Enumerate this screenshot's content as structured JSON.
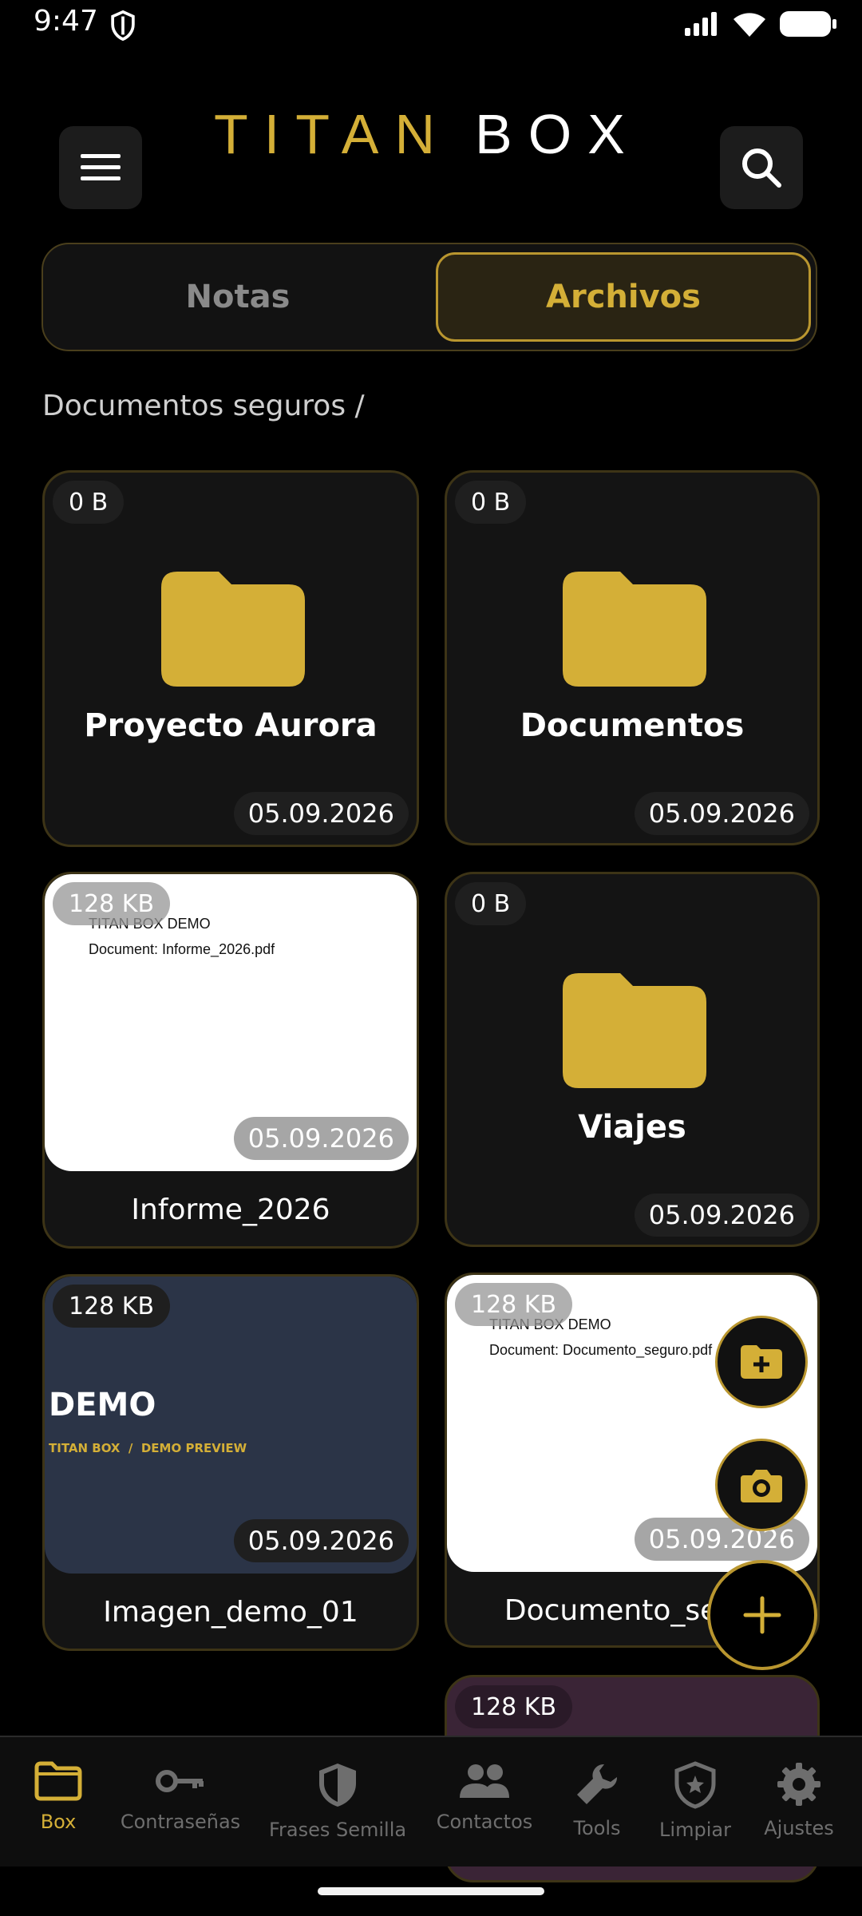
{
  "status_bar": {
    "time": "9:47"
  },
  "header": {
    "logo_part1": "TITAN",
    "logo_part2": "BOX",
    "menu_icon": "hamburger-icon",
    "search_icon": "search-icon"
  },
  "tabs": [
    {
      "label": "Notas",
      "selected": false
    },
    {
      "label": "Archivos",
      "selected": true
    }
  ],
  "breadcrumb": "Documentos seguros /",
  "items": [
    {
      "type": "folder",
      "name": "Proyecto Aurora",
      "size": "0 B",
      "date": "05.09.2026"
    },
    {
      "type": "folder",
      "name": "Documentos",
      "size": "0 B",
      "date": "05.09.2026"
    },
    {
      "type": "file",
      "name": "Informe_2026",
      "size": "128 KB",
      "date": "05.09.2026",
      "preview_line1": "TITAN BOX DEMO",
      "preview_line2": "Document: Informe_2026.pdf"
    },
    {
      "type": "folder",
      "name": "Viajes",
      "size": "0 B",
      "date": "05.09.2026"
    },
    {
      "type": "image",
      "name": "Imagen_demo_01",
      "size": "128 KB",
      "date": "05.09.2026",
      "preview_title": "DEMO",
      "preview_subtitle": "TITAN BOX  /  DEMO PREVIEW"
    },
    {
      "type": "file",
      "name": "Documento_seg",
      "size": "128 KB",
      "date": "05.09.2026",
      "preview_line1": "TITAN BOX DEMO",
      "preview_line2": "Document: Documento_seguro.pdf"
    },
    {
      "type": "file",
      "size": "128 KB"
    }
  ],
  "fabs": {
    "new_folder_icon": "folder-plus-icon",
    "camera_icon": "camera-icon",
    "add_icon": "plus-icon"
  },
  "bottom_nav": [
    {
      "label": "Box",
      "icon": "folder-icon",
      "active": true
    },
    {
      "label": "Contraseñas",
      "icon": "key-icon",
      "active": false
    },
    {
      "label": "Frases Semilla",
      "icon": "shield-half-icon",
      "active": false
    },
    {
      "label": "Contactos",
      "icon": "people-icon",
      "active": false
    },
    {
      "label": "Tools",
      "icon": "wrench-icon",
      "active": false
    },
    {
      "label": "Limpiar",
      "icon": "shield-star-icon",
      "active": false
    },
    {
      "label": "Ajustes",
      "icon": "gear-icon",
      "active": false
    }
  ],
  "colors": {
    "accent": "#d4af37",
    "background": "#000000",
    "card": "#141414"
  }
}
